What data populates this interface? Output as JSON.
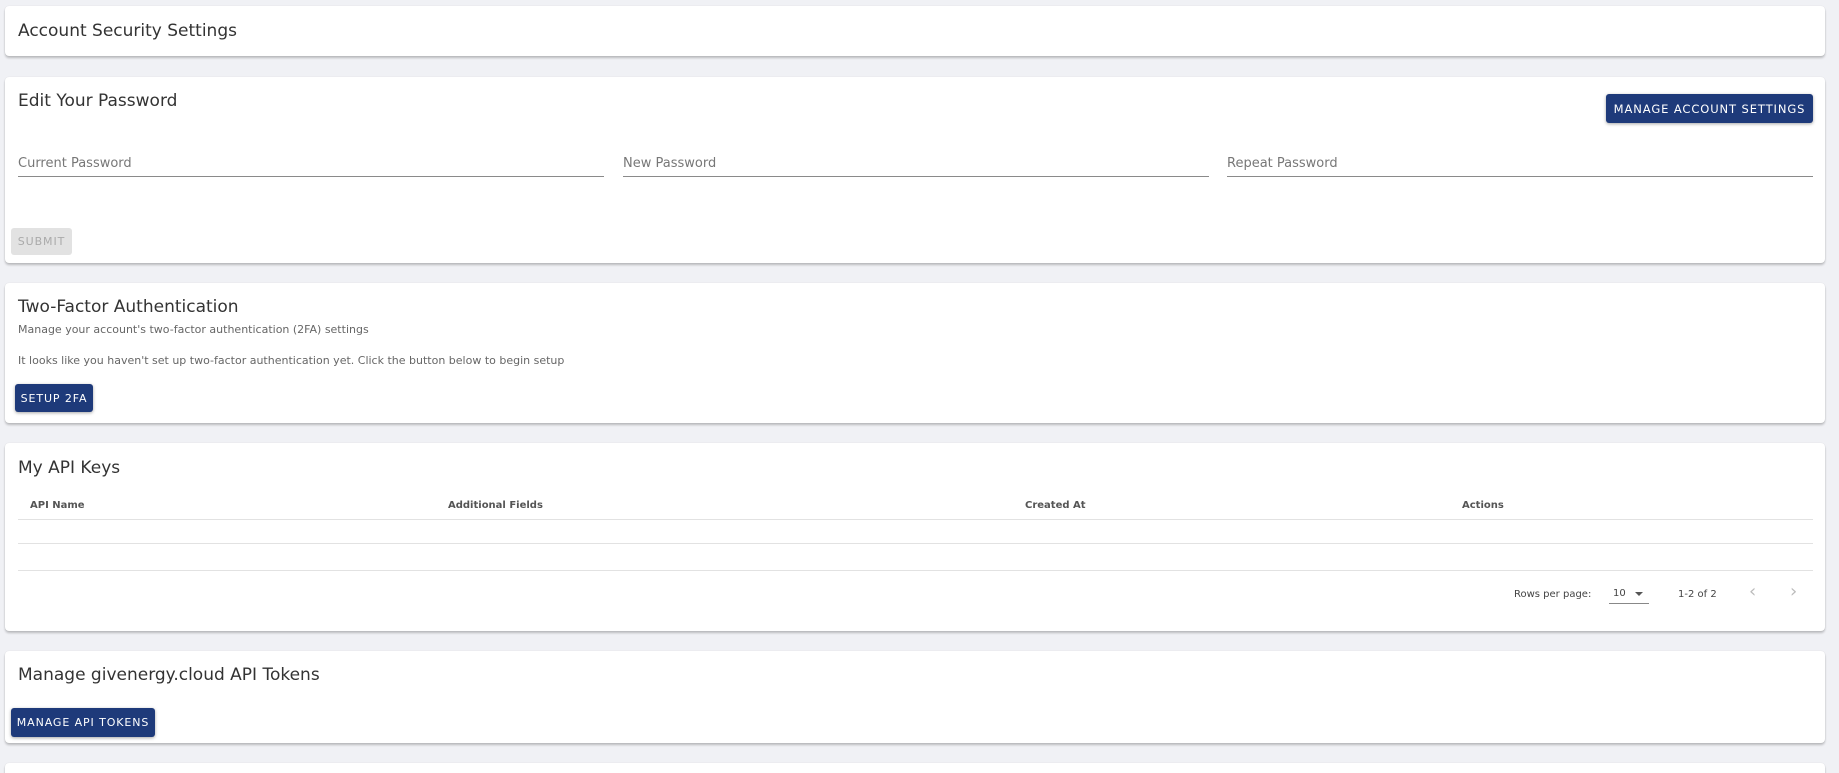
{
  "page_title": "Account Security Settings",
  "password": {
    "title": "Edit Your Password",
    "manage_button": "MANAGE ACCOUNT SETTINGS",
    "current_placeholder": "Current Password",
    "new_placeholder": "New Password",
    "repeat_placeholder": "Repeat Password",
    "submit_label": "SUBMIT"
  },
  "two_factor": {
    "title": "Two-Factor Authentication",
    "subtitle": "Manage your account's two-factor authentication (2FA) settings",
    "message": "It looks like you haven't set up two-factor authentication yet. Click the button below to begin setup",
    "setup_button": "SETUP 2FA"
  },
  "api_keys": {
    "title": "My API Keys",
    "columns": [
      "API Name",
      "Additional Fields",
      "Created At",
      "Actions"
    ],
    "rows_per_page_label": "Rows per page:",
    "rows_per_page_value": "10",
    "range_text": "1-2 of 2"
  },
  "api_tokens": {
    "title": "Manage givenergy.cloud API Tokens",
    "button": "MANAGE API TOKENS"
  },
  "colors": {
    "primary": "#1e3a7a",
    "background": "#f0f1f5"
  }
}
